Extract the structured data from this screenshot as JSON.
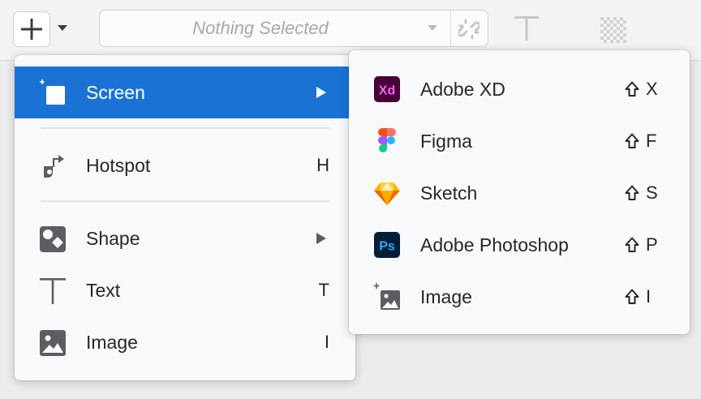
{
  "toolbar": {
    "selector_text": "Nothing Selected"
  },
  "main_menu": {
    "items": [
      {
        "label": "Screen",
        "shortcut": "",
        "has_submenu": true,
        "active": true,
        "icon": "screen-icon"
      },
      {
        "label": "Hotspot",
        "shortcut": "H",
        "has_submenu": false,
        "icon": "hotspot-icon"
      },
      {
        "label": "Shape",
        "shortcut": "",
        "has_submenu": true,
        "icon": "shape-icon"
      },
      {
        "label": "Text",
        "shortcut": "T",
        "has_submenu": false,
        "icon": "text-icon"
      },
      {
        "label": "Image",
        "shortcut": "I",
        "has_submenu": false,
        "icon": "image-icon"
      }
    ]
  },
  "submenu": {
    "items": [
      {
        "label": "Adobe XD",
        "key": "X",
        "icon": "adobe-xd-icon"
      },
      {
        "label": "Figma",
        "key": "F",
        "icon": "figma-icon"
      },
      {
        "label": "Sketch",
        "key": "S",
        "icon": "sketch-icon"
      },
      {
        "label": "Adobe Photoshop",
        "key": "P",
        "icon": "photoshop-icon"
      },
      {
        "label": "Image",
        "key": "I",
        "icon": "image-upload-icon"
      }
    ]
  },
  "colors": {
    "accent": "#1a73d4",
    "menu_bg": "#f8f9fb",
    "text": "#25272c",
    "icon": "#5b5d63"
  }
}
